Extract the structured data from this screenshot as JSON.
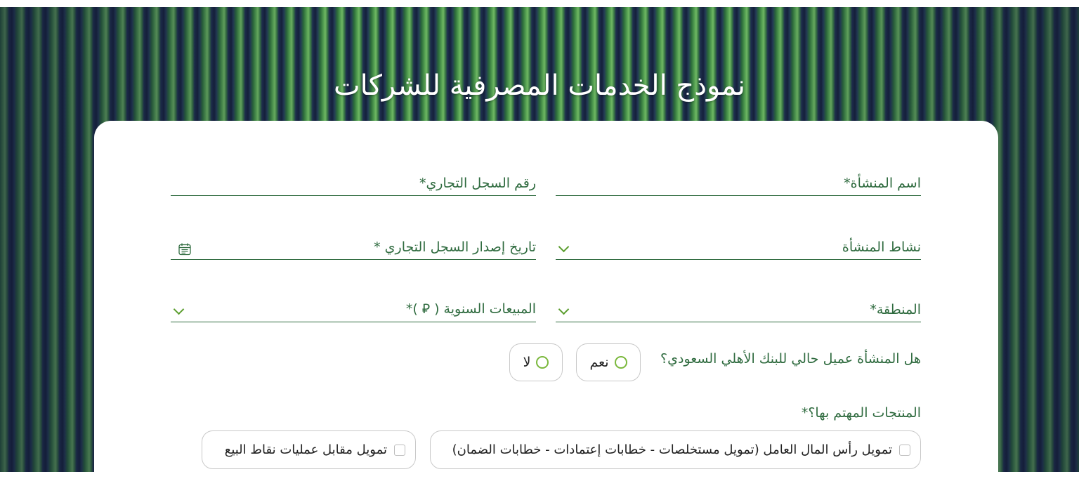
{
  "page": {
    "title": "نموذج الخدمات المصرفية للشركات"
  },
  "form": {
    "establishment_name": {
      "label": "اسم المنشأة*",
      "value": ""
    },
    "cr_number": {
      "label": "رقم السجل التجاري*",
      "value": ""
    },
    "establishment_activity": {
      "label": "نشاط المنشأة",
      "icon": "chevron-down-icon"
    },
    "cr_issue_date": {
      "label": "تاريخ إصدار السجل التجاري *",
      "icon": "calendar-icon"
    },
    "region": {
      "label": "المنطقة*",
      "icon": "chevron-down-icon"
    },
    "annual_sales": {
      "label": "المبيعات السنوية ( ⃁ )*",
      "icon": "chevron-down-icon"
    },
    "existing_customer": {
      "question": "هل المنشأة عميل حالي للبنك الأهلي السعودي؟",
      "options": [
        "نعم",
        "لا"
      ]
    },
    "products": {
      "label": "المنتجات المهتم بها؟*",
      "options": [
        "تمويل رأس المال العامل (تمويل مستخلصات - خطابات إعتمادات - خطابات الضمان)",
        "تمويل مقابل عمليات نقاط البيع"
      ]
    }
  },
  "colors": {
    "label_green": "#2f6b3f",
    "accent_green": "#7ab83c",
    "background_navy": "#1b2747"
  }
}
